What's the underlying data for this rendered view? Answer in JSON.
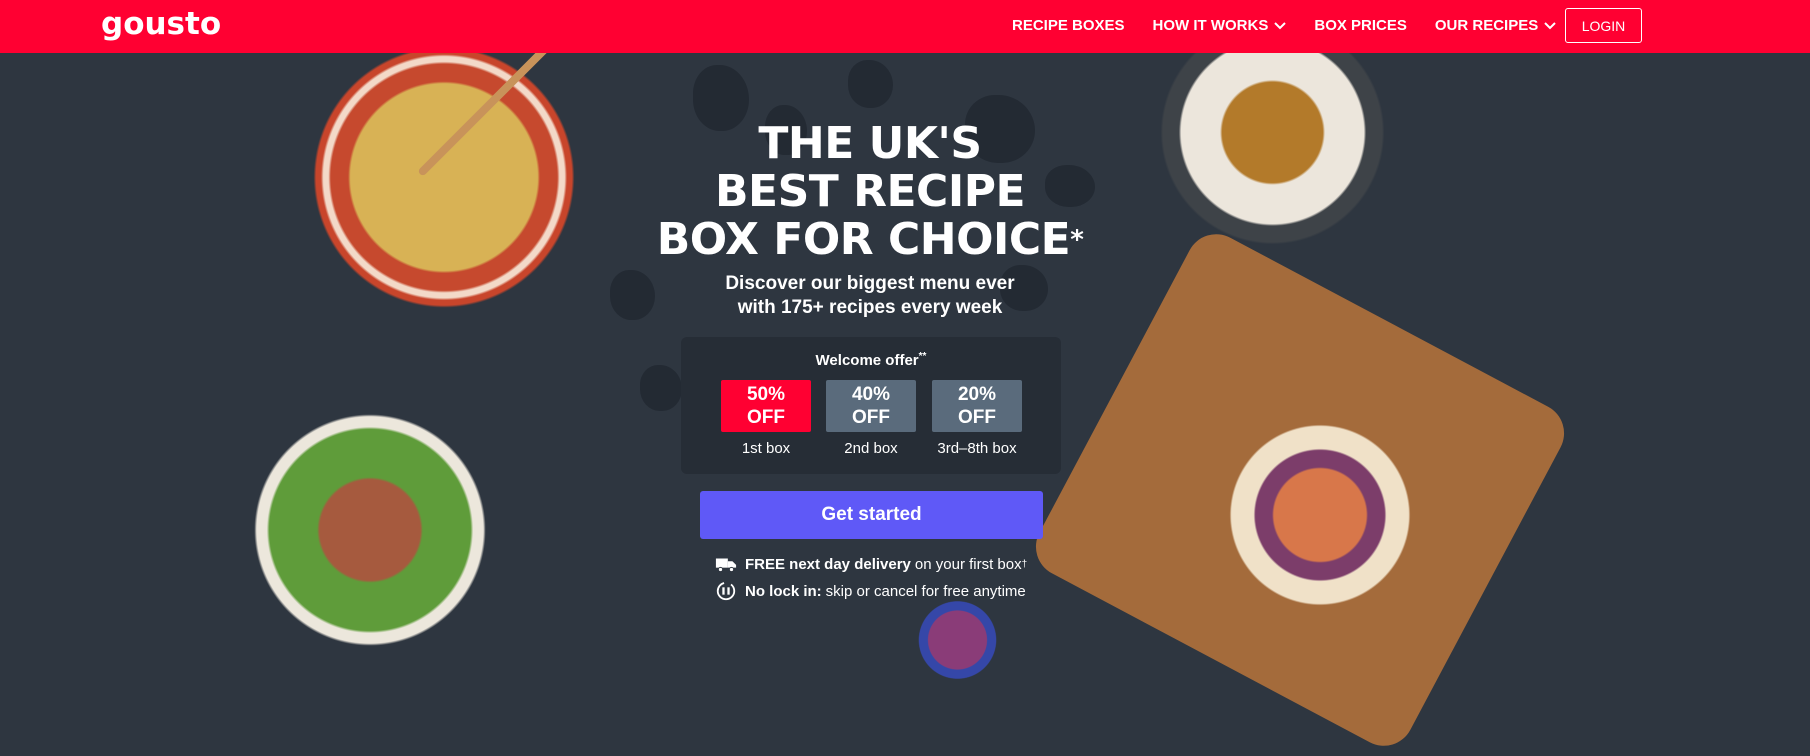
{
  "header": {
    "logo": "gousto",
    "nav": [
      {
        "label": "RECIPE BOXES",
        "dropdown": false
      },
      {
        "label": "HOW IT WORKS",
        "dropdown": true
      },
      {
        "label": "BOX PRICES",
        "dropdown": false
      },
      {
        "label": "OUR RECIPES",
        "dropdown": true
      }
    ],
    "login_label": "LOGIN",
    "brand_color": "#ff0032"
  },
  "hero": {
    "headline_line1": "THE UK'S",
    "headline_line2": "BEST RECIPE",
    "headline_line3": "BOX FOR CHOICE",
    "headline_mark": "*",
    "subline_line1": "Discover our biggest menu ever",
    "subline_line2": "with 175+ recipes every week"
  },
  "offer": {
    "title": "Welcome offer",
    "title_mark": "**",
    "tiers": [
      {
        "percent": "50%",
        "off": "OFF",
        "label": "1st box",
        "color": "#ff0032"
      },
      {
        "percent": "40%",
        "off": "OFF",
        "label": "2nd box",
        "color": "#5a6b7c"
      },
      {
        "percent": "20%",
        "off": "OFF",
        "label": "3rd–8th box",
        "color": "#5a6b7c"
      }
    ]
  },
  "cta": {
    "label": "Get started",
    "color": "#5f59f7"
  },
  "perks": [
    {
      "icon": "delivery-truck-icon",
      "bold": "FREE next day delivery",
      "text": "on your first box",
      "mark": "†"
    },
    {
      "icon": "no-lock-in-icon",
      "bold": "No lock in:",
      "text": "skip or cancel for free anytime",
      "mark": ""
    }
  ]
}
